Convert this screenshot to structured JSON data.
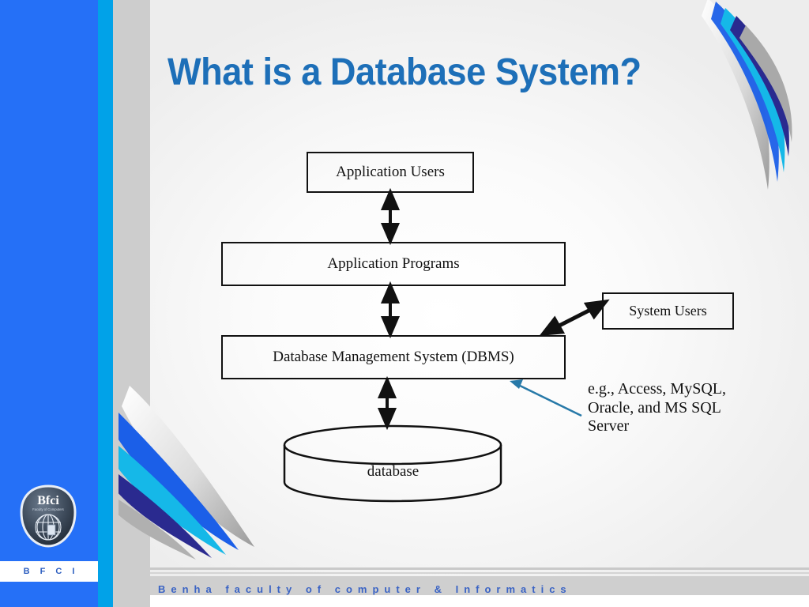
{
  "slide": {
    "title": "What is a Database System?",
    "title_color": "#1d6fb8",
    "background_color": "#ffffff"
  },
  "sidebar": {
    "blue_color": "#2570f7",
    "cyan_color": "#01a2e8",
    "gray_color": "#cdcdcd",
    "logo": {
      "mark_text": "Bfci",
      "mark_subtitle": "Faculty of Computers & Informatics",
      "caption": "B F C I"
    }
  },
  "footer": {
    "text": "Benha faculty of computer & Informatics",
    "text_color": "#3a63c4"
  },
  "diagram": {
    "nodes": [
      {
        "id": "app-users",
        "label": "Application Users"
      },
      {
        "id": "app-programs",
        "label": "Application Programs"
      },
      {
        "id": "dbms",
        "label": "Database Management System (DBMS)"
      },
      {
        "id": "sys-users",
        "label": "System Users"
      },
      {
        "id": "database",
        "label": "database"
      }
    ],
    "annotation": {
      "line1": "e.g., Access, MySQL,",
      "line2": "Oracle, and MS SQL",
      "line3": "Server",
      "leader_color": "#2779a8"
    },
    "connectors": [
      {
        "from": "app-users",
        "to": "app-programs",
        "style": "double-arrow-vertical"
      },
      {
        "from": "app-programs",
        "to": "dbms",
        "style": "double-arrow-vertical"
      },
      {
        "from": "dbms",
        "to": "database",
        "style": "double-arrow-vertical"
      },
      {
        "from": "sys-users",
        "to": "dbms",
        "style": "double-arrow-diagonal"
      }
    ]
  }
}
